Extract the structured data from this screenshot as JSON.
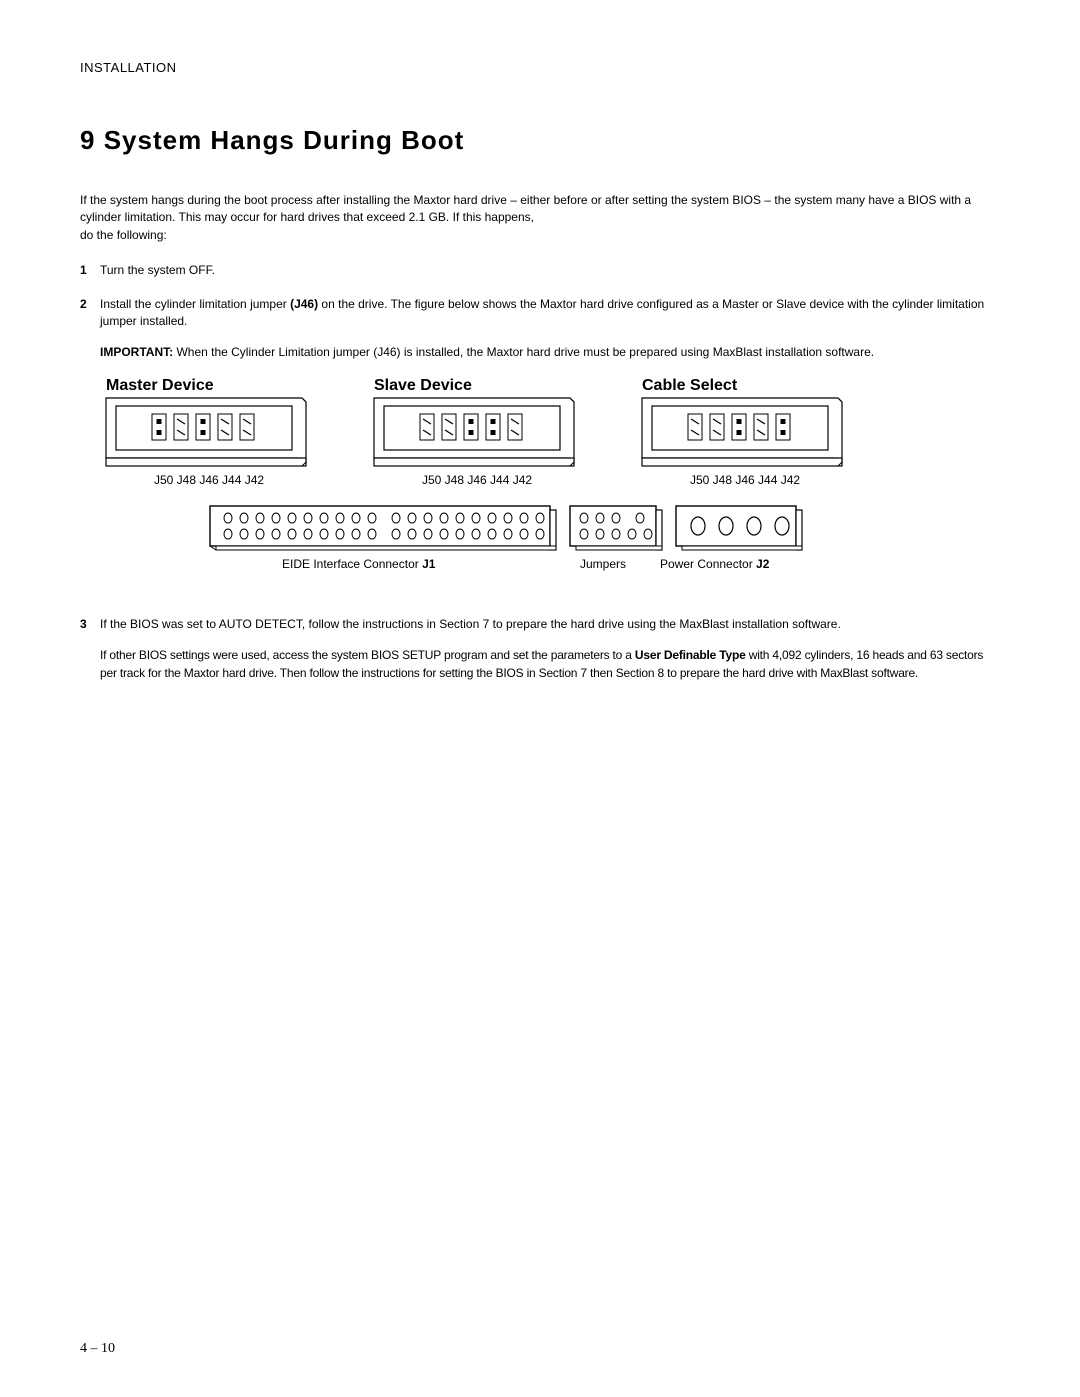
{
  "header": "INSTALLATION",
  "section_number": "9",
  "section_title": "System Hangs During Boot",
  "intro": {
    "line1": "If the system hangs during the boot process after installing the Maxtor hard drive – either before or after setting the system BIOS – the system many have a BIOS with a cylinder limitation. This may occur for hard drives that exceed 2.1 GB. If this happens,",
    "line2": "do the following:"
  },
  "steps": {
    "s1": {
      "num": "1",
      "text": "Turn the system OFF."
    },
    "s2": {
      "num": "2",
      "text_before": "Install the cylinder limitation jumper ",
      "bold": "(J46)",
      "text_after": " on the drive. The figure below shows the Maxtor hard drive configured as a Master or Slave device with the cylinder limitation jumper installed."
    },
    "important": {
      "label": "IMPORTANT:",
      "text": " When the Cylinder Limitation jumper (J46) is installed, the Maxtor hard drive must be prepared using MaxBlast installation software."
    },
    "s3": {
      "num": "3",
      "text": "If the BIOS was set to AUTO DETECT, follow the instructions in Section 7 to prepare the hard drive using the MaxBlast installation software."
    },
    "s3_sub": {
      "before": "If other BIOS settings were used, access the system BIOS SETUP program and set the parameters to a ",
      "bold": "User Definable Type",
      "after": " with 4,092 cylinders, 16 heads and 63 sectors per track for the Maxtor hard drive. Then follow the instructions for setting the BIOS in Section 7 then Section 8 to prepare the hard drive with MaxBlast software."
    }
  },
  "figure": {
    "title_master": "Master Device",
    "title_slave": "Slave Device",
    "title_cable": "Cable Select",
    "jlabels": "J50 J48 J46 J44 J42",
    "conn_eide": "EIDE Interface Connector ",
    "conn_eide_bold": "J1",
    "conn_jumpers": "Jumpers",
    "conn_power": "Power Connector ",
    "conn_power_bold": "J2"
  },
  "page_number": "4 – 10"
}
